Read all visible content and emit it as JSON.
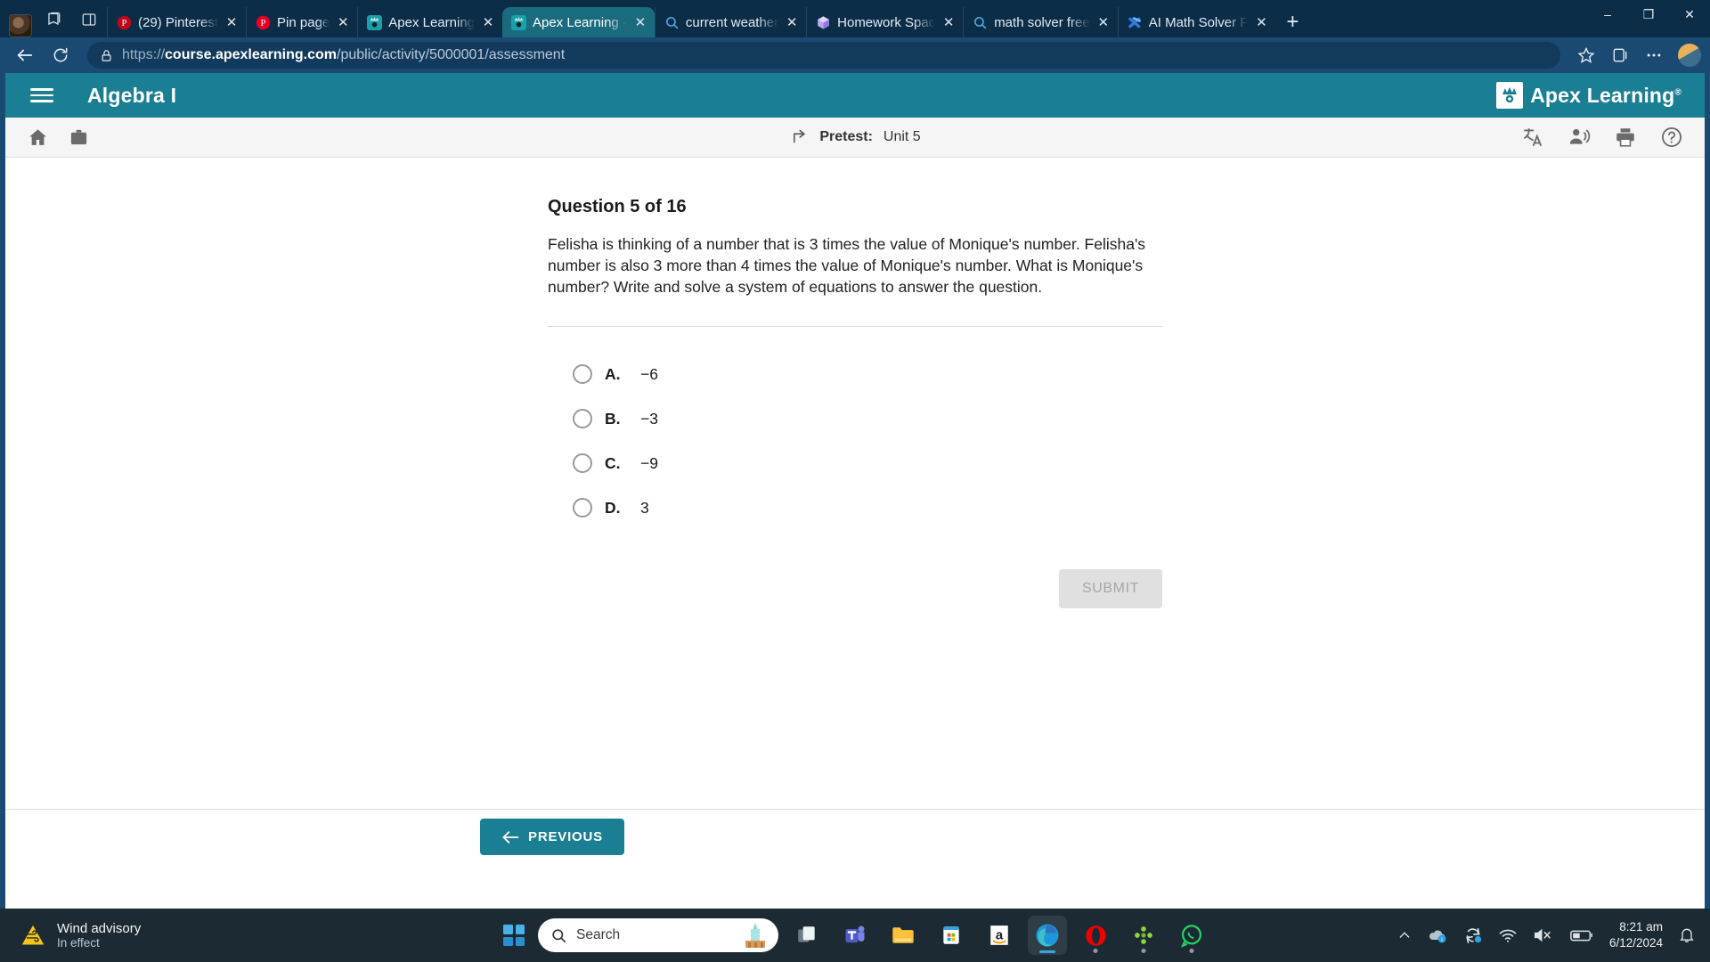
{
  "browser": {
    "tabs": [
      {
        "title": "(29) Pinterest",
        "icon": "pinterest-icon",
        "active": false
      },
      {
        "title": "Pin page",
        "icon": "pinterest-icon",
        "active": false
      },
      {
        "title": "Apex Learning",
        "icon": "apex-icon",
        "active": false
      },
      {
        "title": "Apex Learning -",
        "icon": "apex-icon",
        "active": true
      },
      {
        "title": "current weather",
        "icon": "search-icon",
        "active": false
      },
      {
        "title": "Homework Spac",
        "icon": "homework-icon",
        "active": false
      },
      {
        "title": "math solver free",
        "icon": "search-icon",
        "active": false
      },
      {
        "title": "AI Math Solver F",
        "icon": "ai-math-icon",
        "active": false
      }
    ],
    "tab_close_label": "✕",
    "new_tab_label": "+",
    "window_controls": {
      "minimize": "‒",
      "maximize": "❐",
      "close": "✕"
    },
    "address": {
      "protocol": "https://",
      "domain": "course.apexlearning.com",
      "path": "/public/activity/5000001/assessment",
      "lock_icon": "lock-icon"
    },
    "nav": {
      "back_icon": "back-arrow-icon",
      "reload_icon": "reload-icon",
      "favorite_icon": "star-icon",
      "collections_icon": "collections-icon",
      "settings_icon": "ellipsis-icon",
      "profile_icon": "profile-avatar"
    }
  },
  "app": {
    "menu_icon": "hamburger-menu-icon",
    "course_title": "Algebra I",
    "logo_text": "Apex Learning",
    "logo_trademark": "®",
    "toolbar": {
      "home_icon": "home-icon",
      "briefcase_icon": "briefcase-icon",
      "exit_icon": "exit-activity-icon",
      "activity_type": "Pretest:",
      "activity_name": "Unit 5",
      "translate_icon": "translate-icon",
      "read_aloud_icon": "read-aloud-icon",
      "print_icon": "print-icon",
      "help_icon": "help-icon"
    }
  },
  "question": {
    "heading": "Question 5 of 16",
    "body": "Felisha is thinking of a number that is 3 times the value of Monique's number. Felisha's number is also 3 more than 4 times the value of Monique's number. What is Monique's number? Write and solve a system of equations to answer the question.",
    "choices": [
      {
        "letter": "A.",
        "value": "−6",
        "selected": false
      },
      {
        "letter": "B.",
        "value": "−3",
        "selected": false
      },
      {
        "letter": "C.",
        "value": "−9",
        "selected": false
      },
      {
        "letter": "D.",
        "value": "3",
        "selected": false
      }
    ],
    "submit_label": "SUBMIT",
    "submit_enabled": false
  },
  "footer": {
    "previous_label": "PREVIOUS",
    "previous_icon": "arrow-left-icon"
  },
  "taskbar": {
    "weather": {
      "icon": "wind-advisory-icon",
      "title": "Wind advisory",
      "subtitle": "In effect"
    },
    "start_icon": "windows-start-icon",
    "search": {
      "icon": "search-icon",
      "placeholder": "Search",
      "value": ""
    },
    "apps": [
      {
        "name": "task-view-icon",
        "running": false,
        "active": false
      },
      {
        "name": "microsoft-teams-icon",
        "running": false,
        "active": false
      },
      {
        "name": "file-explorer-icon",
        "running": false,
        "active": false
      },
      {
        "name": "microsoft-store-icon",
        "running": false,
        "active": false
      },
      {
        "name": "amazon-icon",
        "running": false,
        "active": false
      },
      {
        "name": "microsoft-edge-icon",
        "running": true,
        "active": true
      },
      {
        "name": "opera-icon",
        "running": true,
        "active": false
      },
      {
        "name": "game-icon",
        "running": true,
        "active": false
      },
      {
        "name": "whatsapp-icon",
        "running": true,
        "active": false
      }
    ],
    "tray": {
      "chevron_icon": "show-hidden-icons-icon",
      "onedrive_icon": "onedrive-icon",
      "update_icon": "windows-update-icon",
      "wifi_icon": "wifi-icon",
      "volume_icon": "volume-muted-icon",
      "battery_icon": "battery-icon",
      "time": "8:21 am",
      "date": "6/12/2024",
      "notification_icon": "notification-bell-icon"
    }
  },
  "colors": {
    "apex_teal": "#1b7f93",
    "browser_blue": "#1a4a72",
    "taskbar": "#1c2b33",
    "submit_disabled": "#e0e0e0"
  }
}
